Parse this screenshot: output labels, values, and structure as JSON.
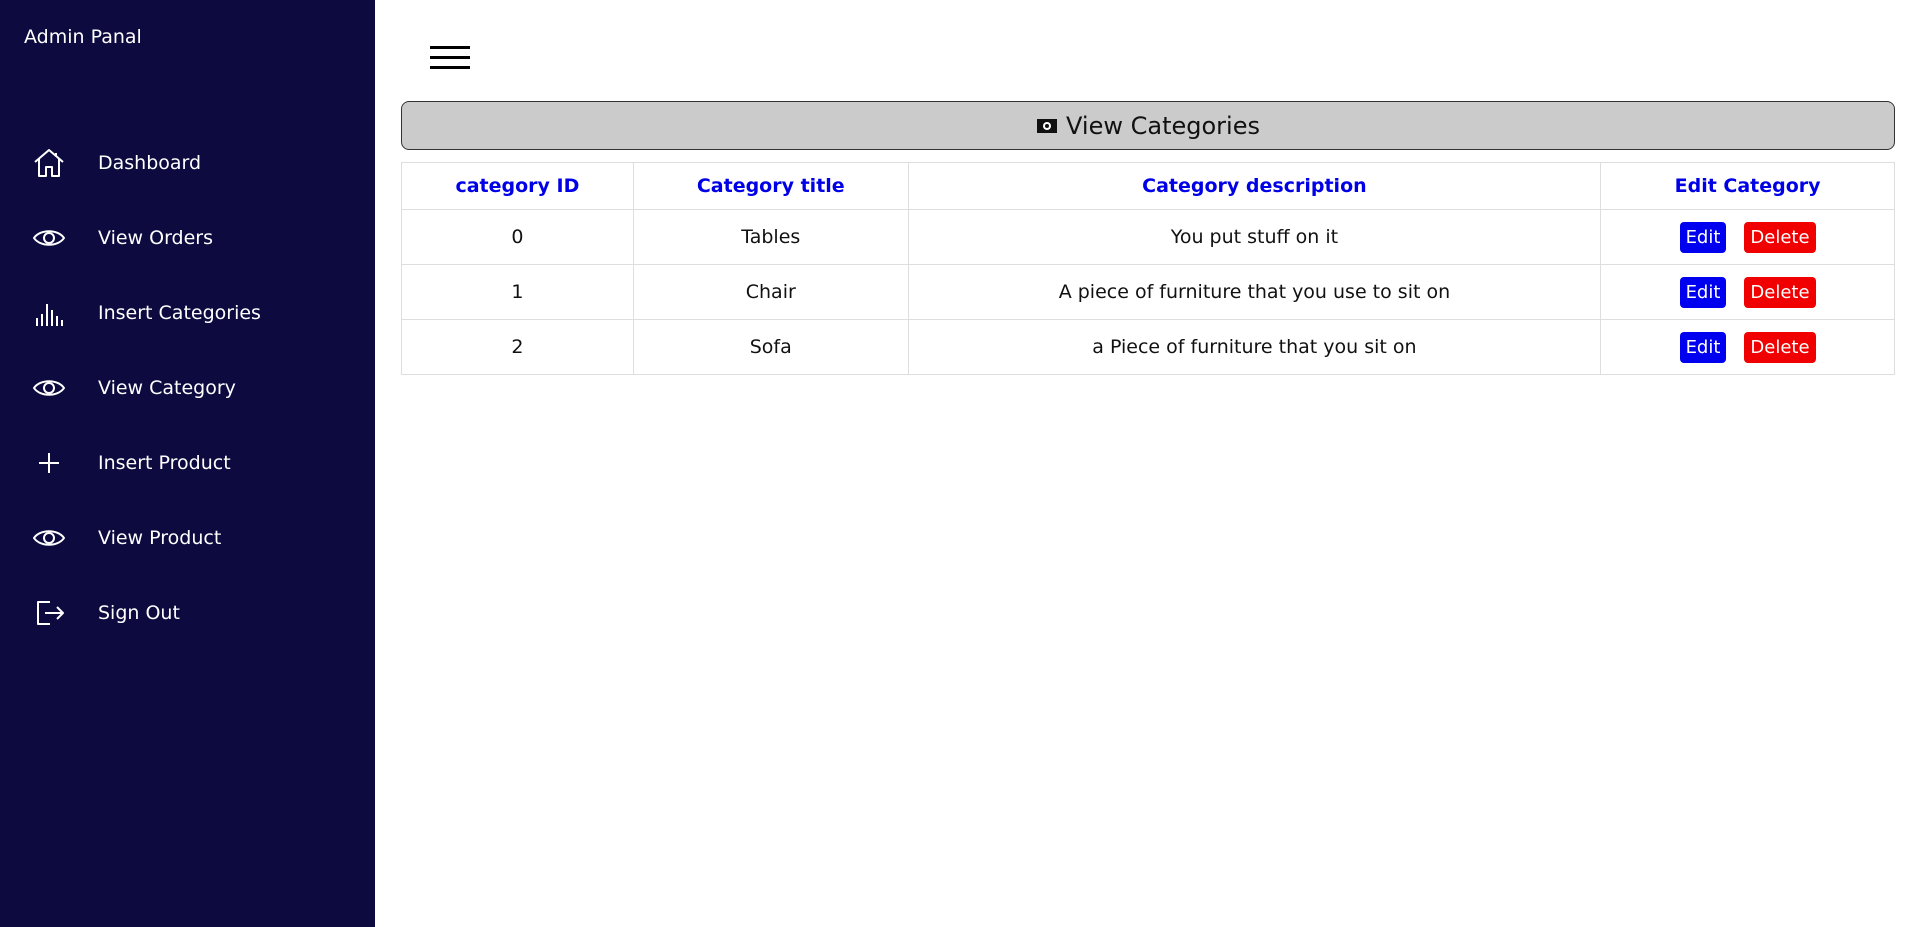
{
  "sidebar": {
    "brand": "Admin Panal",
    "items": [
      {
        "label": "Dashboard",
        "icon": "home-icon"
      },
      {
        "label": "View Orders",
        "icon": "eye-icon"
      },
      {
        "label": "Insert Categories",
        "icon": "bar-chart-icon"
      },
      {
        "label": "View Category",
        "icon": "eye-icon"
      },
      {
        "label": "Insert Product",
        "icon": "plus-icon"
      },
      {
        "label": "View Product",
        "icon": "eye-icon"
      },
      {
        "label": "Sign Out",
        "icon": "sign-out-icon"
      }
    ]
  },
  "header": {
    "title": "View Categories",
    "icon": "money-icon"
  },
  "table": {
    "columns": [
      "category ID",
      "Category title",
      "Category description",
      "Edit Category"
    ],
    "rows": [
      {
        "id": "0",
        "title": "Tables",
        "description": "You put stuff on it",
        "edit": "Edit",
        "delete": "Delete"
      },
      {
        "id": "1",
        "title": "Chair",
        "description": "A piece of furniture that you use to sit on",
        "edit": "Edit",
        "delete": "Delete"
      },
      {
        "id": "2",
        "title": "Sofa",
        "description": "a Piece of furniture that you sit on",
        "edit": "Edit",
        "delete": "Delete"
      }
    ]
  },
  "colors": {
    "sidebar_bg": "#0c0a3e",
    "header_bg": "#cbcbcb",
    "column_header_text": "#0000e6",
    "edit_button": "#0000f0",
    "delete_button": "#f00000"
  }
}
